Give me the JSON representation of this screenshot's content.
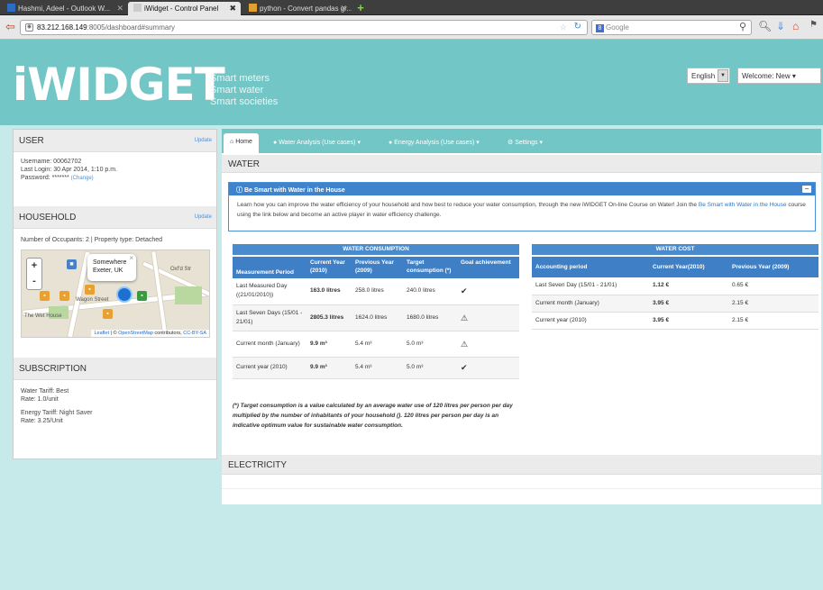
{
  "browser": {
    "tabs": [
      {
        "label": "Hashmi, Adeel - Outlook W...",
        "active": false
      },
      {
        "label": "iWidget - Control Panel",
        "active": true
      },
      {
        "label": "python - Convert pandas gr...",
        "active": false
      }
    ],
    "url_host": "83.212.168.149",
    "url_rest": ":8005/dashboard#summary",
    "search_placeholder": "Google"
  },
  "header": {
    "logo": "iWIDGET",
    "tagline_1": "Smart meters",
    "tagline_2": "Smart water",
    "tagline_3": "Smart societies",
    "language": "English",
    "welcome": "Welcome: New"
  },
  "user": {
    "title": "USER",
    "update": "Update",
    "username": "Username: 00062702",
    "last_login": "Last Login: 30 Apr 2014, 1:10 p.m.",
    "password": "Password: *******",
    "change": "(Change)"
  },
  "household": {
    "title": "HOUSEHOLD",
    "update": "Update",
    "info": "Number of Occupants: 2 | Property type: Detached",
    "popup_line1": "Somewhere",
    "popup_line2": "Exeter, UK",
    "attr_leaflet": "Leaflet",
    "attr_mid": " | © ",
    "attr_osm": "OpenStreetMap",
    "attr_contrib": " contributors, ",
    "attr_cc": "CC-BY-SA",
    "label_street": "Wagon Street",
    "label_church": "The Wet House",
    "label_oxford": "Oxf'd Str"
  },
  "subscription": {
    "title": "SUBSCRIPTION",
    "water_tariff": "Water Tariff: Best",
    "water_rate": "Rate: 1.0/unit",
    "energy_tariff": "Energy Tariff: Night Saver",
    "energy_rate": "Rate: 3.25/Unit"
  },
  "tabs": {
    "home": "Home",
    "water": "Water Analysis (Use cases)",
    "energy": "Energy Analysis (Use cases)",
    "settings": "Settings"
  },
  "water": {
    "title": "WATER",
    "info_title": "Be Smart with Water in the House",
    "info_text_1": "Learn how you can improve the water efficiency of your household and how best to reduce your water consumption, through the new iWIDGET On-line Course on Water! Join the ",
    "info_link": "Be Smart with Water in the House",
    "info_text_2": " course using the link below and become an active player in water efficiency challenge.",
    "consumption_title": "WATER CONSUMPTION",
    "consumption_headers": [
      "Measurement Period",
      "Current Year (2010)",
      "Previous Year (2009)",
      "Target consumption (*)",
      "Goal achievement"
    ],
    "consumption_rows": [
      [
        "Last Measured Day ((21/01/2010))",
        "163.0 litres",
        "258.0 litres",
        "240.0 litres",
        "✔"
      ],
      [
        "Last Seven Days (15/01 - 21/01)",
        "2805.3 litres",
        "1624.0 litres",
        "1680.0 litres",
        "⚠"
      ],
      [
        "Current month (January)",
        "9.9 m³",
        "5.4 m³",
        "5.0 m³",
        "⚠"
      ],
      [
        "Current year (2010)",
        "9.9 m³",
        "5.4 m³",
        "5.0 m³",
        "✔"
      ]
    ],
    "cost_title": "WATER COST",
    "cost_headers": [
      "Accounting period",
      "Current Year(2010)",
      "Previous Year (2009)"
    ],
    "cost_rows": [
      [
        "Last Seven Day (15/01 - 21/01)",
        "1.12 €",
        "0.65 €"
      ],
      [
        "Current month (January)",
        "3.95 €",
        "2.15 €"
      ],
      [
        "Current year (2010)",
        "3.95 €",
        "2.15 €"
      ]
    ],
    "note": "(*) Target consumption is a value calculated by an average water use of 120 litres per person per day multiplied by the number of inhabitants of your household (). 120 litres per person per day is an indicative optimum value for sustainable water consumption."
  },
  "electricity": {
    "title": "ELECTRICITY"
  },
  "colors": {
    "header_teal": "#72c6c6",
    "table_blue": "#3f7fc6",
    "background": "#c6e9e9"
  }
}
